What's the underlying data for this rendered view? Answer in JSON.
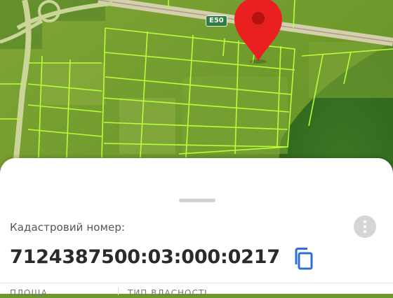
{
  "map": {
    "highway_badge": "E50",
    "colors": {
      "field": "#6f9a2a",
      "parcel_line": "#b8ff3a",
      "road": "#c9c2a6",
      "pin": "#ea2020",
      "forest": "#2f6a1e"
    }
  },
  "sheet": {
    "cadastral_label": "Кадастровий номер:",
    "cadastral_number": "7124387500:03:000:0217",
    "more_icon": "more-vert-icon",
    "copy_icon": "copy-icon",
    "columns": [
      "ПЛОЩА",
      "ТИП ВЛАСНОСТІ"
    ]
  }
}
